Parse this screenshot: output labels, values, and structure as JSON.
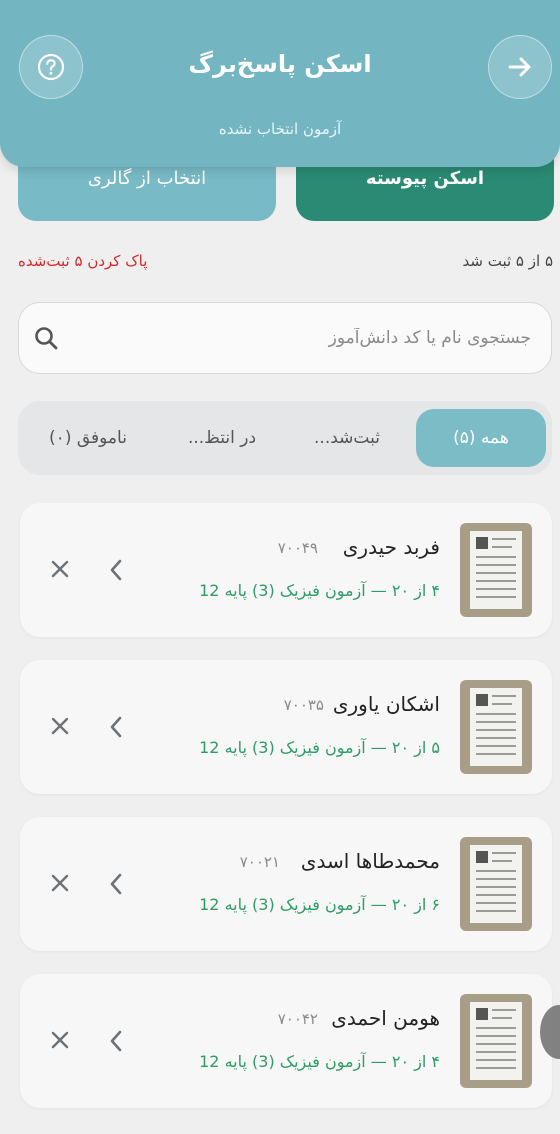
{
  "header": {
    "title": "اسکن پاسخ‌برگ",
    "subtitle": "آزمون انتخاب نشده"
  },
  "actions": {
    "gallery_label": "انتخاب از گالری",
    "continuous_label": "اسکن پیوسته"
  },
  "status": {
    "count_text": "۵ از ۵ ثبت شد",
    "clear_label": "پاک کردن ۵ ثبت‌شده"
  },
  "search": {
    "placeholder": "جستجوی نام یا کد دانش‌آموز"
  },
  "tabs": [
    {
      "label": "همه (۵)",
      "active": true
    },
    {
      "label": "ثبت‌شد..."
    },
    {
      "label": "در انتظ..."
    },
    {
      "label": "ناموفق (۰)"
    }
  ],
  "students": [
    {
      "name": "فربد حیدری",
      "code": "۷۰۰۴۹",
      "detail": "۴ از ۲۰ — آزمون فیزیک (3) پایه 12"
    },
    {
      "name": "اشکان یاوری",
      "code": "۷۰۰۳۵",
      "detail": "۵ از ۲۰ — آزمون فیزیک (3) پایه 12"
    },
    {
      "name": "محمدطاها اسدی",
      "code": "۷۰۰۲۱",
      "detail": "۶ از ۲۰ — آزمون فیزیک (3) پایه 12"
    },
    {
      "name": "هومن احمدی",
      "code": "۷۰۰۴۲",
      "detail": "۴ از ۲۰ — آزمون فیزیک (3) پایه 12"
    }
  ],
  "colors": {
    "header": "#73b6c1",
    "primary": "#2a8a73",
    "danger": "#d12b2b",
    "success_text": "#2e9c66"
  }
}
